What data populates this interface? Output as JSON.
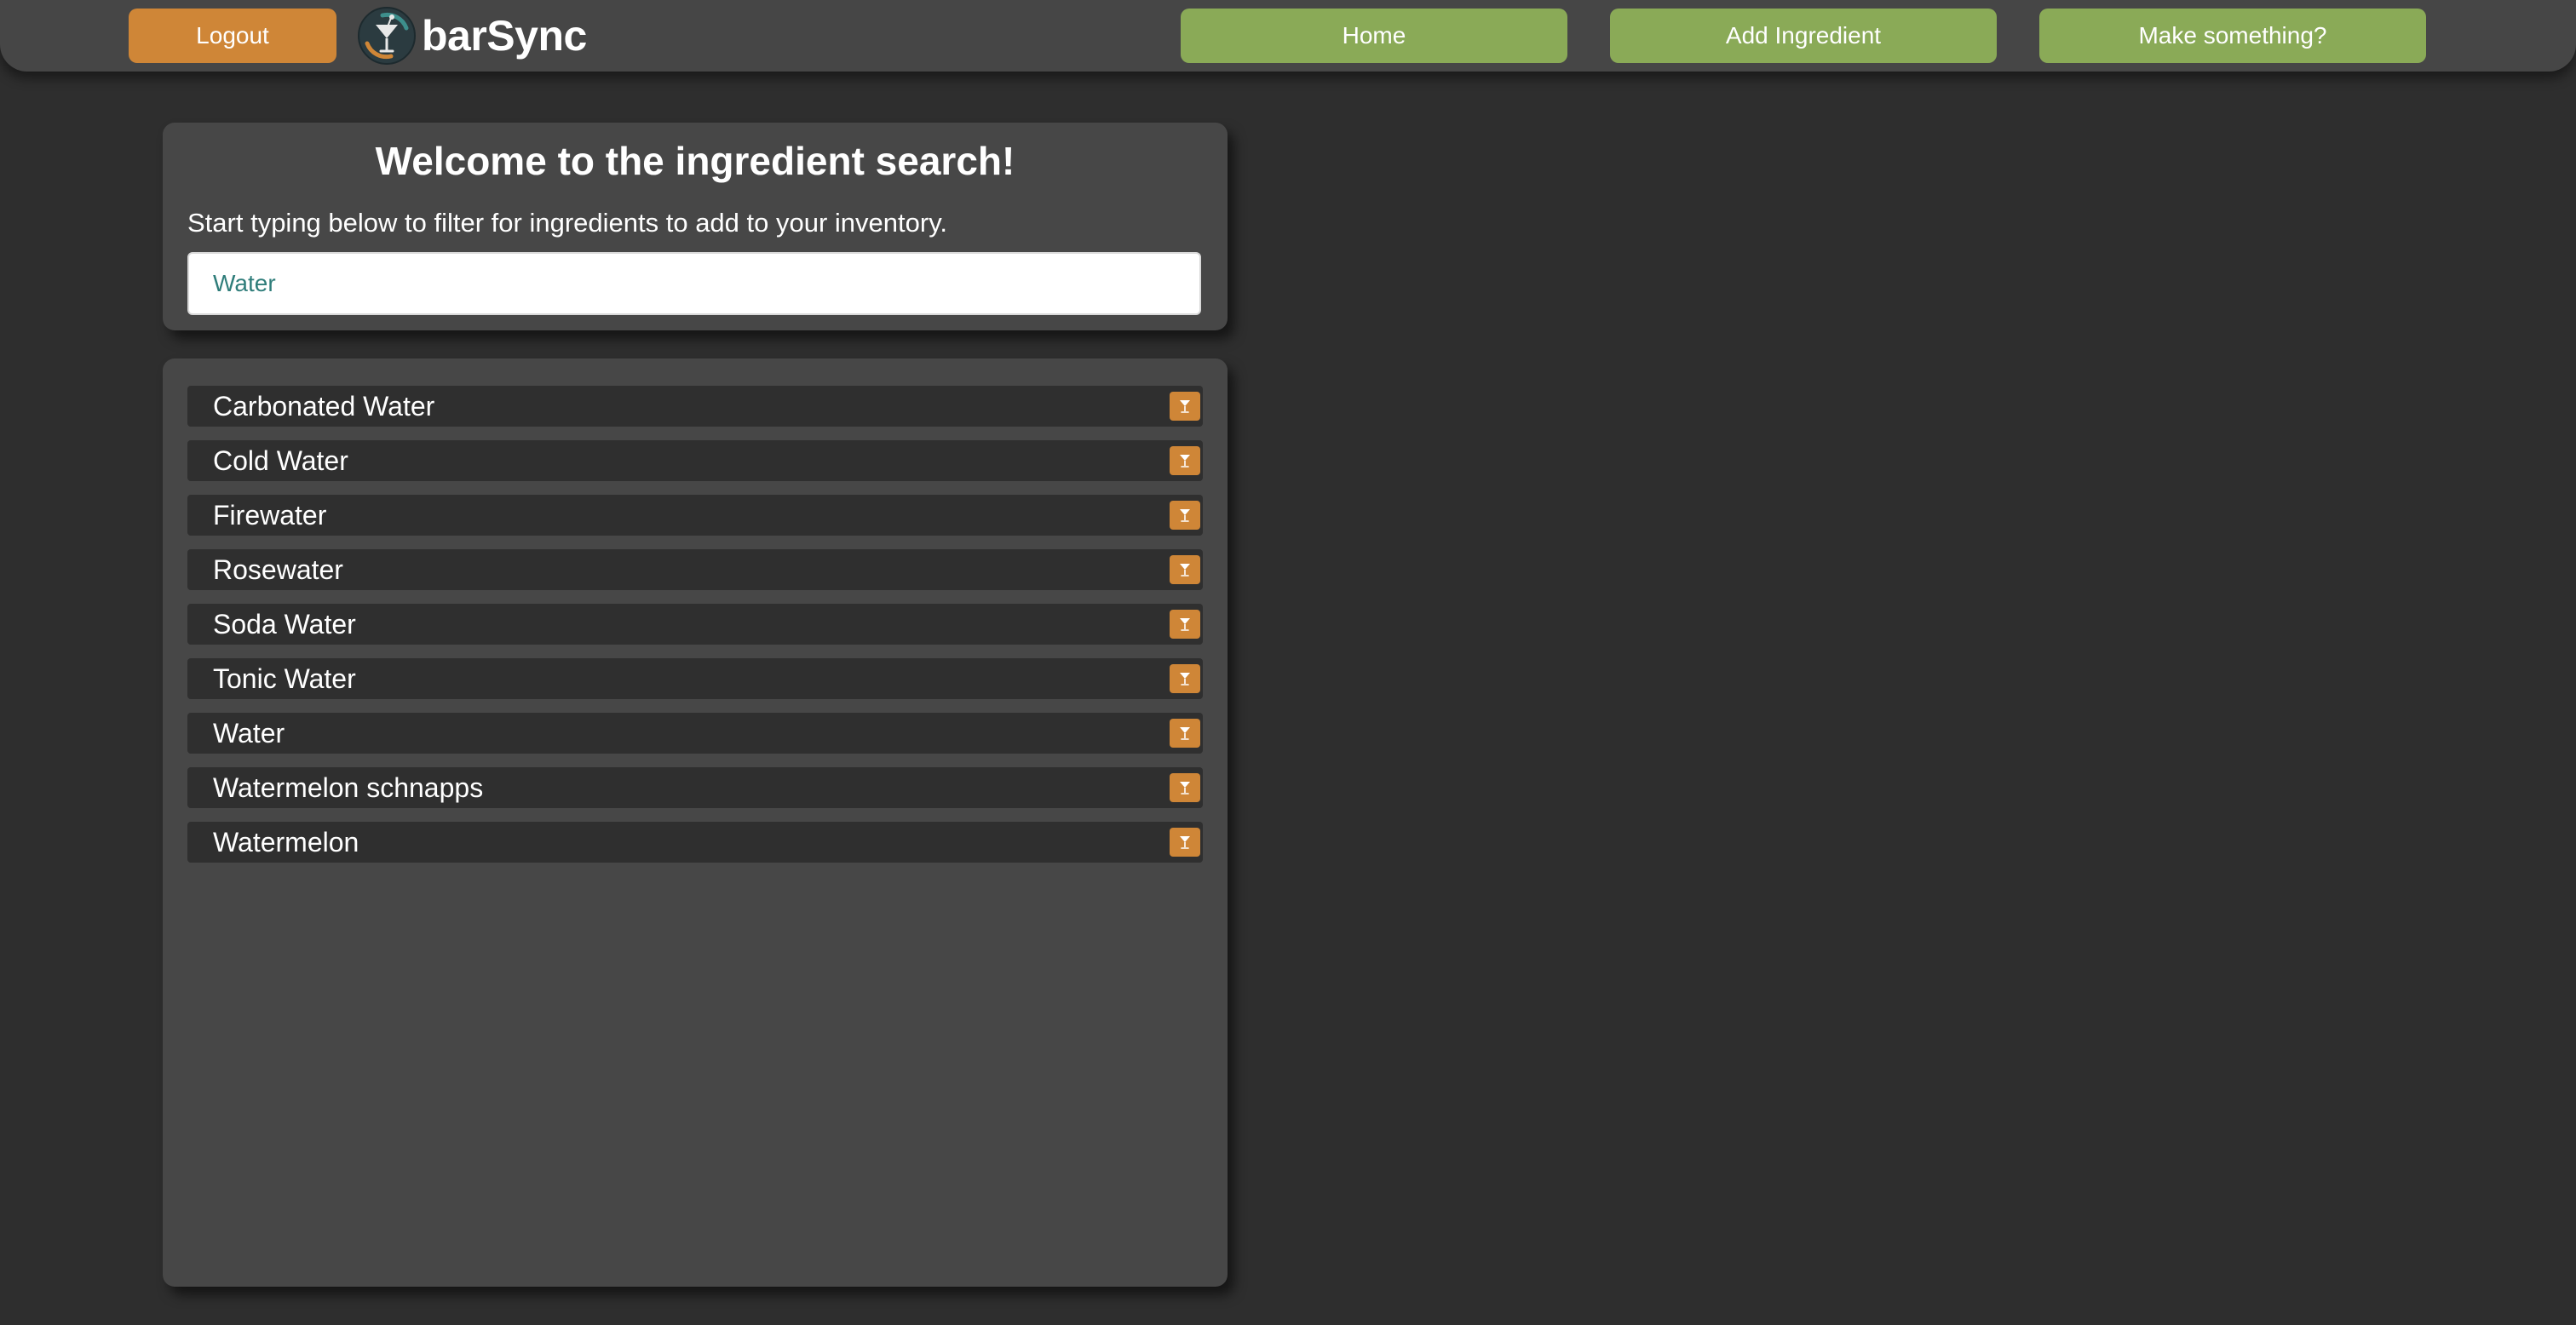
{
  "nav": {
    "logout_label": "Logout",
    "brand_name": "barSync",
    "brand_logo_icon": "cocktail-logo-icon",
    "items": [
      {
        "label": "Home"
      },
      {
        "label": "Add Ingredient"
      },
      {
        "label": "Make something?"
      }
    ]
  },
  "search": {
    "title": "Welcome to the ingredient search!",
    "subtitle": "Start typing below to filter for ingredients to add to your inventory.",
    "value": "Water"
  },
  "results": {
    "add_icon": "cocktail-glass-icon",
    "items": [
      {
        "name": "Carbonated Water"
      },
      {
        "name": "Cold Water"
      },
      {
        "name": "Firewater"
      },
      {
        "name": "Rosewater"
      },
      {
        "name": "Soda Water"
      },
      {
        "name": "Tonic Water"
      },
      {
        "name": "Water"
      },
      {
        "name": "Watermelon schnapps"
      },
      {
        "name": "Watermelon"
      }
    ]
  },
  "colors": {
    "background": "#2e2e2e",
    "panel": "#474747",
    "row": "#2f2f2f",
    "accent_orange": "#cf8637",
    "accent_green": "#8aaa57",
    "input_text": "#2f7d7a"
  }
}
